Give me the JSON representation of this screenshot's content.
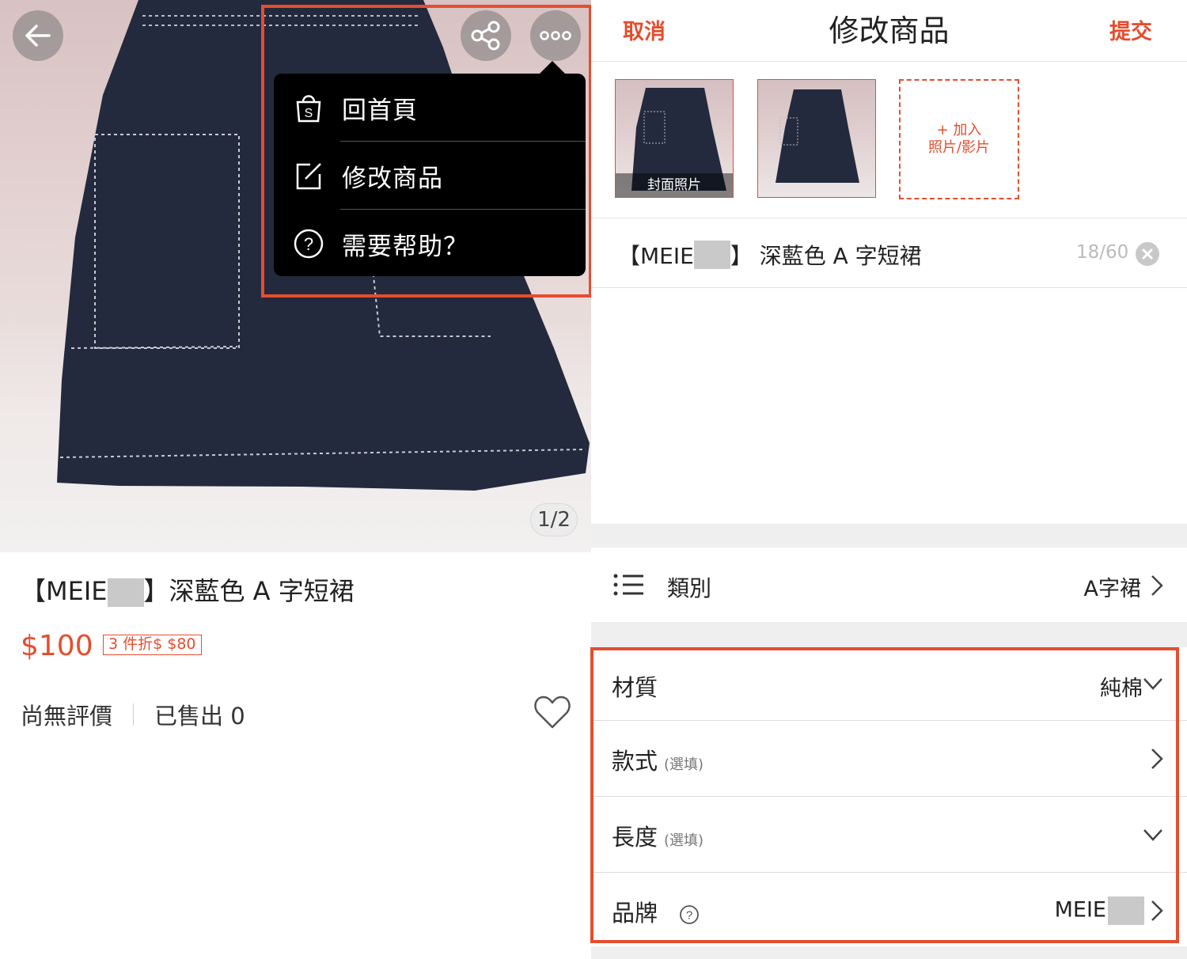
{
  "left": {
    "image_counter": "1/2",
    "menu": {
      "items": [
        {
          "label": "回首頁",
          "icon": "shopee-bag-icon"
        },
        {
          "label": "修改商品",
          "icon": "edit-icon"
        },
        {
          "label": "需要帮助？",
          "icon": "help-icon"
        }
      ]
    },
    "product": {
      "title_prefix": "【MEIE",
      "title_suffix": "】深藍色 A 字短裙",
      "price": "$100",
      "promo": "3 件折$ $80",
      "reviews": "尚無評價",
      "sold": "已售出 0"
    },
    "accent_color": "#e54d2e"
  },
  "right": {
    "header": {
      "cancel": "取消",
      "title": "修改商品",
      "submit": "提交"
    },
    "cover_label": "封面照片",
    "add_photo_line1": "+ 加入",
    "add_photo_line2": "照片/影片",
    "name": {
      "prefix": "【MEIE",
      "suffix": "】 深藍色 A 字短裙",
      "count": "18/60"
    },
    "category": {
      "label": "類別",
      "value": "A字裙"
    },
    "attributes": {
      "material": {
        "label": "材質",
        "value": "純棉"
      },
      "style": {
        "label": "款式",
        "optional": "(選填)"
      },
      "length": {
        "label": "長度",
        "optional": "(選填)"
      },
      "brand": {
        "label": "品牌",
        "value": "MEIE"
      }
    }
  }
}
